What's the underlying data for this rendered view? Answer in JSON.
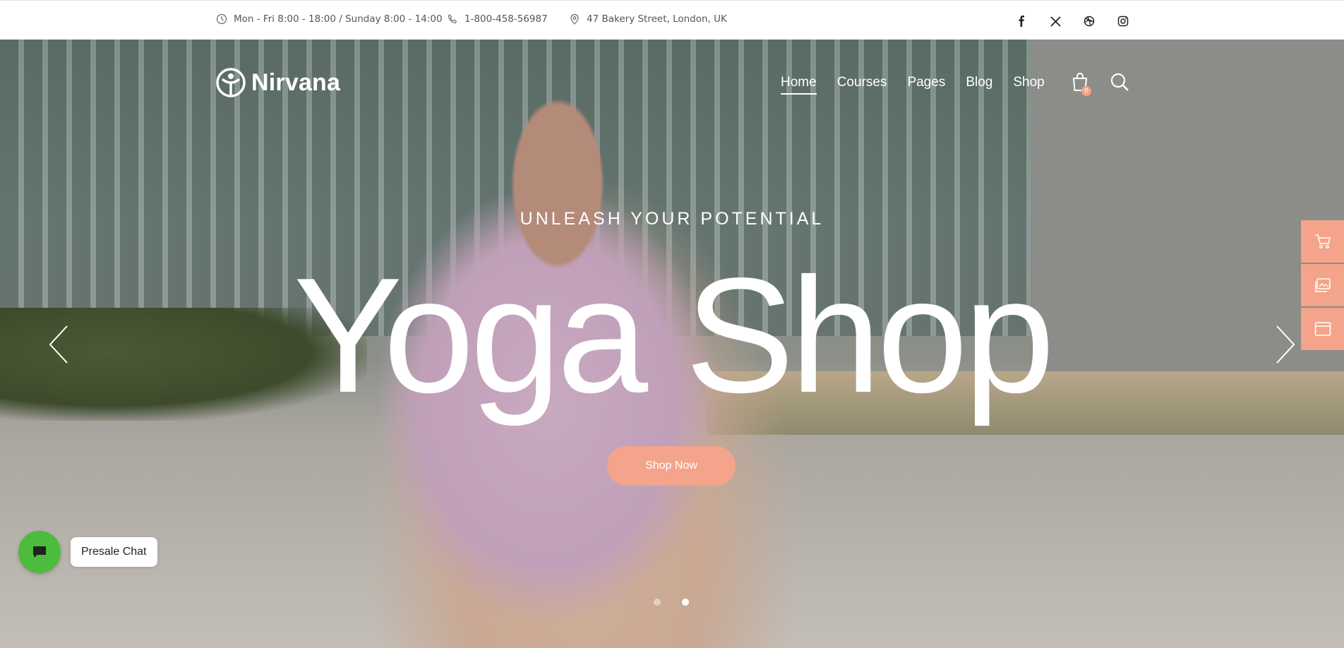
{
  "topbar": {
    "hours": "Mon - Fri 8:00 - 18:00 / Sunday 8:00 - 14:00",
    "phone": "1-800-458-56987",
    "address": "47 Bakery Street, London, UK",
    "social": [
      "facebook-icon",
      "x-icon",
      "dribbble-icon",
      "instagram-icon"
    ]
  },
  "header": {
    "logo_text": "Nirvana",
    "nav": [
      {
        "label": "Home",
        "active": true
      },
      {
        "label": "Courses"
      },
      {
        "label": "Pages"
      },
      {
        "label": "Blog"
      },
      {
        "label": "Shop"
      }
    ],
    "cart_count": "0"
  },
  "hero": {
    "subtitle": "UNLEASH YOUR POTENTIAL",
    "title": "Yoga Shop",
    "button_label": "Shop Now",
    "slides": 2,
    "active_slide": 2
  },
  "side_tools": [
    "cart-icon",
    "gallery-icon",
    "window-icon"
  ],
  "chat": {
    "label": "Presale Chat"
  },
  "colors": {
    "accent": "#f3a48a",
    "chat_green": "#4cbb3e"
  }
}
